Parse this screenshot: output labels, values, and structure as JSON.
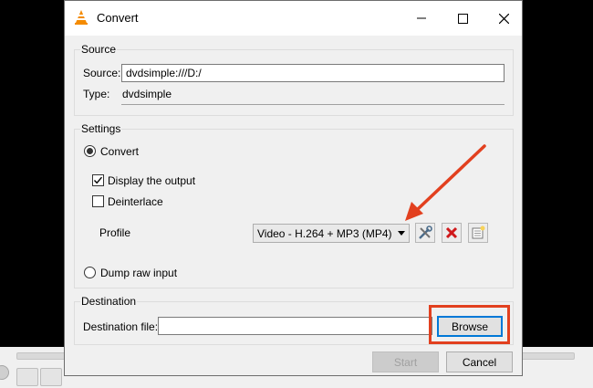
{
  "window": {
    "title": "Convert",
    "icon": "vlc-cone-icon"
  },
  "source": {
    "group_title": "Source",
    "source_label": "Source:",
    "source_value": "dvdsimple:///D:/",
    "type_label": "Type:",
    "type_value": "dvdsimple"
  },
  "settings": {
    "group_title": "Settings",
    "convert_label": "Convert",
    "convert_selected": true,
    "display_output_label": "Display the output",
    "display_output_checked": true,
    "deinterlace_label": "Deinterlace",
    "deinterlace_checked": false,
    "profile_label": "Profile",
    "profile_value": "Video - H.264 + MP3 (MP4)",
    "profile_tools": [
      "tools-icon",
      "delete-icon",
      "new-profile-icon"
    ],
    "dump_raw_label": "Dump raw input",
    "dump_raw_selected": false
  },
  "destination": {
    "group_title": "Destination",
    "file_label": "Destination file:",
    "file_value": "",
    "browse_label": "Browse"
  },
  "footer": {
    "start_label": "Start",
    "cancel_label": "Cancel"
  },
  "annotations": {
    "color": "#e2401f"
  }
}
